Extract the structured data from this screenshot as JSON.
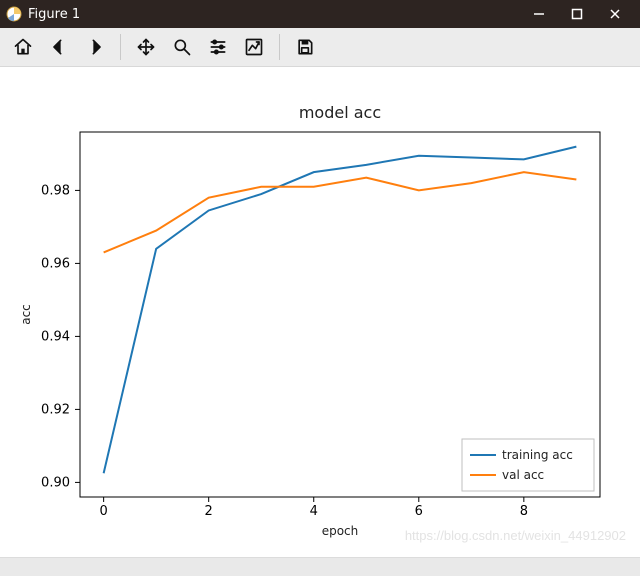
{
  "window": {
    "title": "Figure 1"
  },
  "toolbar": {
    "home": "Home",
    "back": "Back",
    "forward": "Forward",
    "pan": "Pan",
    "zoom": "Zoom",
    "subplots": "Configure subplots",
    "axes": "Edit axes",
    "save": "Save"
  },
  "watermark": "https://blog.csdn.net/weixin_44912902",
  "chart_data": {
    "type": "line",
    "title": "model acc",
    "xlabel": "epoch",
    "ylabel": "acc",
    "x": [
      0,
      1,
      2,
      3,
      4,
      5,
      6,
      7,
      8,
      9
    ],
    "xticks": [
      0,
      2,
      4,
      6,
      8
    ],
    "yticks": [
      0.9,
      0.92,
      0.94,
      0.96,
      0.98
    ],
    "xlim": [
      -0.45,
      9.45
    ],
    "ylim": [
      0.896,
      0.996
    ],
    "legend_position": "lower right",
    "series": [
      {
        "name": "training acc",
        "color": "#1f77b4",
        "values": [
          0.9025,
          0.964,
          0.9745,
          0.979,
          0.985,
          0.987,
          0.9895,
          0.989,
          0.9885,
          0.992
        ]
      },
      {
        "name": "val acc",
        "color": "#ff7f0e",
        "values": [
          0.963,
          0.969,
          0.978,
          0.981,
          0.981,
          0.9835,
          0.98,
          0.982,
          0.985,
          0.983
        ]
      }
    ]
  }
}
